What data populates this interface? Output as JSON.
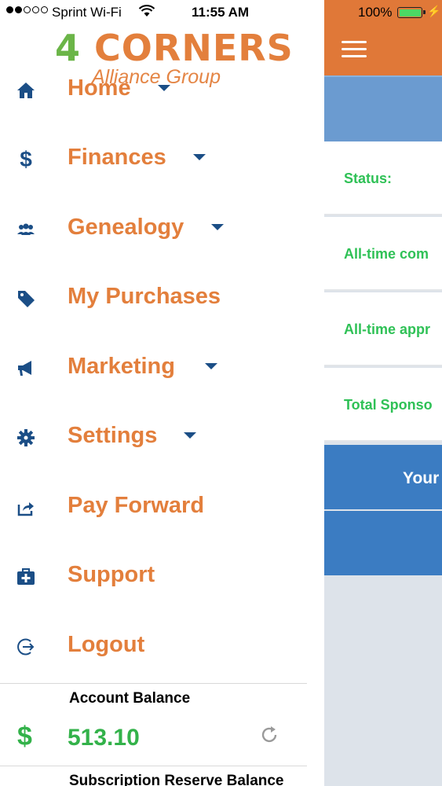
{
  "status_bar": {
    "carrier": "Sprint Wi-Fi",
    "time": "11:55 AM",
    "battery_percent": "100%",
    "signal_bars_filled": 2,
    "signal_bars_total": 5
  },
  "logo": {
    "number": "4",
    "word": "CORNERS",
    "subtitle": "Alliance Group"
  },
  "menu": {
    "items": [
      {
        "label": "Home",
        "icon": "home-icon",
        "has_dropdown": true
      },
      {
        "label": "Finances",
        "icon": "dollar-icon",
        "has_dropdown": true
      },
      {
        "label": "Genealogy",
        "icon": "users-icon",
        "has_dropdown": true
      },
      {
        "label": "My Purchases",
        "icon": "tags-icon",
        "has_dropdown": false
      },
      {
        "label": "Marketing",
        "icon": "megaphone-icon",
        "has_dropdown": true
      },
      {
        "label": "Settings",
        "icon": "gear-icon",
        "has_dropdown": true
      },
      {
        "label": "Pay Forward",
        "icon": "share-icon",
        "has_dropdown": false
      },
      {
        "label": "Support",
        "icon": "medkit-icon",
        "has_dropdown": false
      },
      {
        "label": "Logout",
        "icon": "logout-icon",
        "has_dropdown": false
      }
    ]
  },
  "account": {
    "balance_label": "Account Balance",
    "currency_symbol": "$",
    "balance_value": "513.10",
    "subscription_label": "Subscription Reserve Balance"
  },
  "content": {
    "rows": [
      {
        "label": "Status:"
      },
      {
        "label": "All-time com"
      },
      {
        "label": "All-time appr"
      },
      {
        "label": "Total Sponso"
      }
    ],
    "your_bar_label": "Your"
  },
  "colors": {
    "brand_orange": "#e37f3c",
    "brand_green": "#6bb548",
    "nav_icon_blue": "#1b4e86",
    "topbar_orange": "#e07838",
    "accent_blue": "#3b7cc2",
    "stat_green": "#2fc156"
  }
}
